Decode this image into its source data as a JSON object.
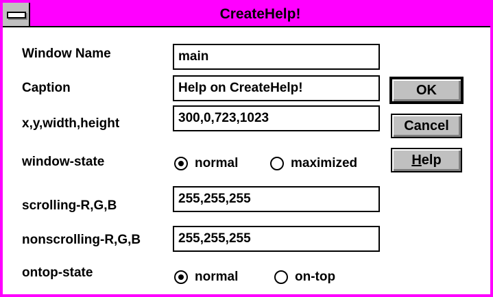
{
  "window": {
    "title": "CreateHelp!",
    "frame_color": "#ff00ff"
  },
  "fields": {
    "window_name": {
      "label": "Window Name",
      "value": "main"
    },
    "caption": {
      "label": "Caption",
      "value": "Help on CreateHelp!"
    },
    "geometry": {
      "label": "x,y,width,height",
      "value": "300,0,723,1023"
    },
    "scrolling": {
      "label": "scrolling-R,G,B",
      "value": "255,255,255"
    },
    "nonscrolling": {
      "label": "nonscrolling-R,G,B",
      "value": "255,255,255"
    }
  },
  "window_state": {
    "label": "window-state",
    "options": [
      "normal",
      "maximized"
    ],
    "selected": "normal"
  },
  "ontop_state": {
    "label": "ontop-state",
    "options": [
      "normal",
      "on-top"
    ],
    "selected": "normal"
  },
  "buttons": {
    "ok": "OK",
    "cancel": "Cancel",
    "help_prefix": "H",
    "help_rest": "elp"
  }
}
